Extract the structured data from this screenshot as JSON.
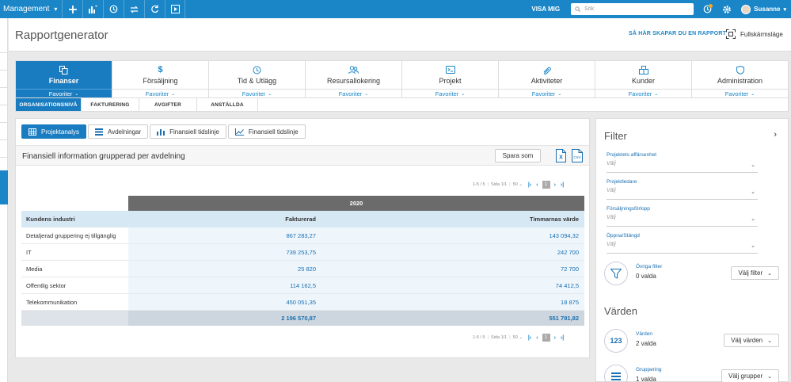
{
  "topbar": {
    "app": "Management",
    "visa": "VISA MIG",
    "search_placeholder": "Sök",
    "user": "Susanne"
  },
  "header": {
    "title": "Rapportgenerator",
    "howto": "SÅ HÄR SKAPAR DU EN RAPPORT",
    "fullscreen": "Fullskärmsläge"
  },
  "modules": [
    {
      "label": "Finanser",
      "fav": "Favoriter",
      "icon": "finance-icon"
    },
    {
      "label": "Försäljning",
      "fav": "Favoriter",
      "icon": "dollar-icon"
    },
    {
      "label": "Tid & Utlägg",
      "fav": "Favoriter",
      "icon": "clock-icon"
    },
    {
      "label": "Resursallokering",
      "fav": "Favoriter",
      "icon": "people-icon"
    },
    {
      "label": "Projekt",
      "fav": "Favoriter",
      "icon": "project-icon"
    },
    {
      "label": "Aktiviteter",
      "fav": "Favoriter",
      "icon": "paperclip-icon"
    },
    {
      "label": "Kunder",
      "fav": "Favoriter",
      "icon": "building-icon"
    },
    {
      "label": "Administration",
      "fav": "Favoriter",
      "icon": "shield-icon"
    }
  ],
  "subtabs": [
    "ORGANISATIONSNIVÅ",
    "FAKTURERING",
    "AVGIFTER",
    "ANSTÄLLDA"
  ],
  "viewtabs": [
    "Projektanalys",
    "Avdelningar",
    "Finansiell tidslinje",
    "Finansiell tidslinje"
  ],
  "report": {
    "title": "Finansiell information grupperad per avdelning",
    "save": "Spara som",
    "csv": "CSV"
  },
  "pager": {
    "range": "1-5 / 5",
    "page": "Sida 1/1",
    "size": "50",
    "current": "1"
  },
  "table": {
    "year": "2020",
    "headers": [
      "Kundens industri",
      "Fakturerad",
      "Timmarnas värde"
    ],
    "rows": [
      [
        "Detaljerad gruppering ej tillgänglig",
        "867 283,27",
        "143 094,32"
      ],
      [
        "IT",
        "739 253,75",
        "242 700"
      ],
      [
        "Media",
        "25 820",
        "72 700"
      ],
      [
        "Offentlig sektor",
        "114 162,5",
        "74 412,5"
      ],
      [
        "Telekommunikation",
        "450 051,35",
        "18 875"
      ]
    ],
    "totals": [
      "2 196 570,87",
      "551 781,82"
    ]
  },
  "filter": {
    "title": "Filter",
    "selects": [
      {
        "label": "Projektets affärsenhet",
        "value": "Välj"
      },
      {
        "label": "Projektledare",
        "value": "Välj"
      },
      {
        "label": "Försäljningsförlopp",
        "value": "Välj"
      },
      {
        "label": "Öppna/Stängd",
        "value": "Välj"
      }
    ],
    "other": {
      "label": "Övriga filter",
      "value": "0 valda",
      "button": "Välj filter"
    },
    "varden_title": "Värden",
    "values": {
      "label": "Värden",
      "value": "2 valda",
      "button": "Välj värden",
      "badge": "123"
    },
    "grouping": {
      "label": "Gruppering",
      "value": "1 valda",
      "button": "Välj grupper"
    }
  },
  "colors": {
    "accent": "#1a86c8",
    "active": "#1a7cc0",
    "header_band": "#6b6b6b"
  }
}
